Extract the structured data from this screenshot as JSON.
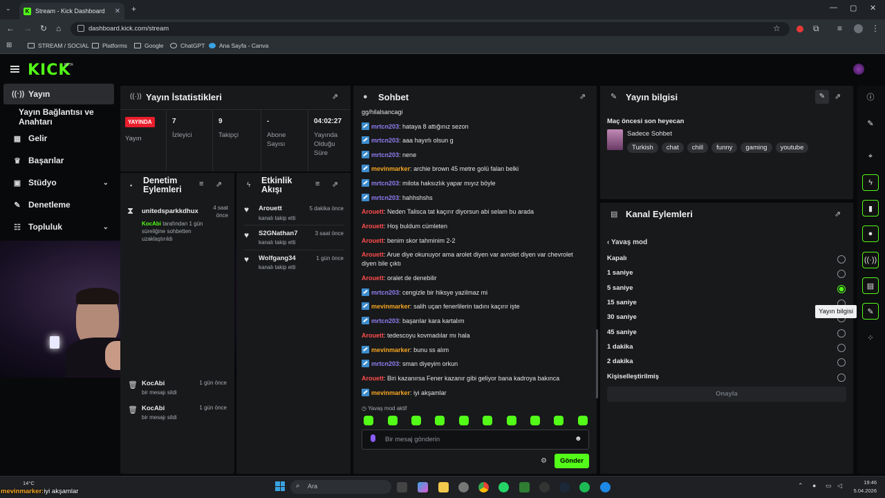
{
  "browser": {
    "tab_title": "Stream - Kick Dashboard",
    "url": "dashboard.kick.com/stream",
    "bookmarks": [
      "STREAM / SOCIAL",
      "Platforms",
      "Google",
      "ChatGPT",
      "Ana Sayfa - Canva"
    ]
  },
  "brand": {
    "logo": "KICK",
    "beta": "BETA",
    "accent": "#53fc18"
  },
  "sidebar": {
    "items": [
      {
        "label": "Yayın",
        "icon": "broadcast-icon"
      },
      {
        "label": "Yayın Bağlantısı ve Anahtarı",
        "icon": ""
      },
      {
        "label": "Gelir",
        "icon": "revenue-icon"
      },
      {
        "label": "Başarılar",
        "icon": "trophy-icon"
      },
      {
        "label": "Stüdyo",
        "icon": "studio-icon"
      },
      {
        "label": "Denetleme",
        "icon": "wrench-icon"
      },
      {
        "label": "Topluluk",
        "icon": "community-icon"
      }
    ]
  },
  "stats": {
    "title": "Yayın İstatistikleri",
    "live_badge": "YAYINDA",
    "live_label": "Yayın",
    "cols": [
      {
        "value": "7",
        "label": "İzleyici"
      },
      {
        "value": "9",
        "label": "Takipçi"
      },
      {
        "value": "-",
        "label": "Abone Sayısı"
      },
      {
        "value": "04:02:27",
        "label": "Yayında Olduğu Süre"
      }
    ]
  },
  "moderation": {
    "title": "Denetim Eylemleri",
    "items": [
      {
        "user": "unitedsparkkdhux",
        "time": "4 saat önce",
        "by": "KocAbi",
        "desc": "tarafından 1 gün süreliğine sohbetten uzaklaştırıldı"
      },
      {
        "user": "KocAbi",
        "time": "1 gün önce",
        "desc": "bir mesajı sildi"
      },
      {
        "user": "KocAbi",
        "time": "1 gün önce",
        "desc": "bir mesajı sildi"
      }
    ]
  },
  "activity": {
    "title": "Etkinlik Akışı",
    "items": [
      {
        "user": "Arouett",
        "time": "5 dakika önce",
        "desc": "kanalı takip etti"
      },
      {
        "user": "S2GNathan7",
        "time": "3 saat önce",
        "desc": "kanalı takip etti"
      },
      {
        "user": "Wolfgang34",
        "time": "1 gün önce",
        "desc": "kanalı takip etti"
      }
    ]
  },
  "chat": {
    "title": "Sohbet",
    "top_line": "gg/hilalsancagi",
    "slow_mode": "Yavaş mod aktif",
    "placeholder": "Bir mesaj gönderin",
    "send": "Gönder",
    "messages": [
      {
        "user": "mrtcn203",
        "color": "#8e7df0",
        "text": "hataya 8 attığınız sezon",
        "badge": true
      },
      {
        "user": "mrtcn203",
        "color": "#8e7df0",
        "text": "aaa hayırlı olsun g",
        "badge": true
      },
      {
        "user": "mrtcn203",
        "color": "#8e7df0",
        "text": "nene",
        "badge": true
      },
      {
        "user": "mevinmarker",
        "color": "#f5a623",
        "text": "archie brown 45 metre golü falan belki",
        "badge": true
      },
      {
        "user": "mrtcn203",
        "color": "#8e7df0",
        "text": "milota haksızlık yapar mıyız böyle",
        "badge": true
      },
      {
        "user": "mrtcn203",
        "color": "#8e7df0",
        "text": "hahhshshs",
        "badge": true
      },
      {
        "user": "Arouett",
        "color": "#ff4d4d",
        "text": "Neden Talisca tat kaçırır diyorsun abi selam bu arada",
        "badge": false
      },
      {
        "user": "Arouett",
        "color": "#ff4d4d",
        "text": "Hoş buldum cümleten",
        "badge": false
      },
      {
        "user": "Arouett",
        "color": "#ff4d4d",
        "text": "benim skor tahminim 2-2",
        "badge": false
      },
      {
        "user": "Arouett",
        "color": "#ff4d4d",
        "text": "Arue diye okunuyor ama arolet diyen var avrolet diyen var chevrolet diyen bile çıktı",
        "badge": false
      },
      {
        "user": "Arouett",
        "color": "#ff4d4d",
        "text": "oralet de denebilir",
        "badge": false
      },
      {
        "user": "mrtcn203",
        "color": "#8e7df0",
        "text": "cengizle bir hiksye yazilmaz mi",
        "badge": true
      },
      {
        "user": "mevinmarker",
        "color": "#f5a623",
        "text": "salih uçan fenerlilerin tadını kaçırır işte",
        "badge": true
      },
      {
        "user": "mrtcn203",
        "color": "#8e7df0",
        "text": "başarılar kara kartalım",
        "badge": true
      },
      {
        "user": "Arouett",
        "color": "#ff4d4d",
        "text": "tedescoyu kovmadılar mı hala",
        "badge": false
      },
      {
        "user": "mevinmarker",
        "color": "#f5a623",
        "text": "bunu ss alım",
        "badge": true
      },
      {
        "user": "mrtcn203",
        "color": "#8e7df0",
        "text": "sman diyeyim orkun",
        "badge": true
      },
      {
        "user": "Arouett",
        "color": "#ff4d4d",
        "text": "Biri kazanırsa Fener kazanır gibi geliyor bana kadroya bakınca",
        "badge": false
      },
      {
        "user": "mevinmarker",
        "color": "#f5a623",
        "text": "iyi akşamlar",
        "badge": true
      }
    ]
  },
  "stream_info": {
    "title": "Yayın bilgisi",
    "stream_title": "Maç öncesi son heyecan",
    "category": "Sadece Sohbet",
    "tags": [
      "Turkish",
      "chat",
      "chill",
      "funny",
      "gaming",
      "youtube"
    ],
    "tooltip": "Yayın bilgisi"
  },
  "channel_actions": {
    "title": "Kanal Eylemleri",
    "back_label": "Yavaş mod",
    "options": [
      "Kapalı",
      "1 saniye",
      "5 saniye",
      "15 saniye",
      "30 saniye",
      "45 saniye",
      "1 dakika",
      "2 dakika",
      "Kişiselleştirilmiş"
    ],
    "selected": "5 saniye",
    "confirm": "Onayla"
  },
  "taskbar": {
    "weather": "14°C",
    "search": "Ara",
    "time": "19:46",
    "date": "5.04.2026",
    "overlay_user": "mevinmarker:",
    "overlay_text": "iyi akşamlar"
  }
}
